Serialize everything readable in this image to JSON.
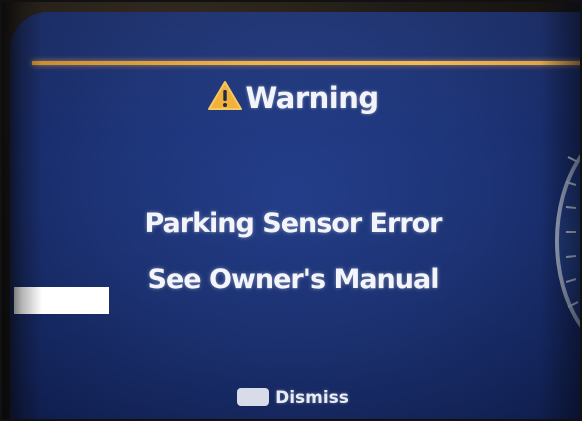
{
  "alert": {
    "title": "Warning",
    "icon": "warning-triangle-icon",
    "message_line_1": "Parking Sensor Error",
    "message_line_2": "See Owner's Manual"
  },
  "footer": {
    "key_icon": "ok-button-key-icon",
    "dismiss_label": "Dismiss"
  },
  "colors": {
    "screen_background": "#1d3478",
    "accent_line": "#f0b24a",
    "warning_icon_fill": "#f2b13a",
    "text": "#f2f4fa"
  }
}
